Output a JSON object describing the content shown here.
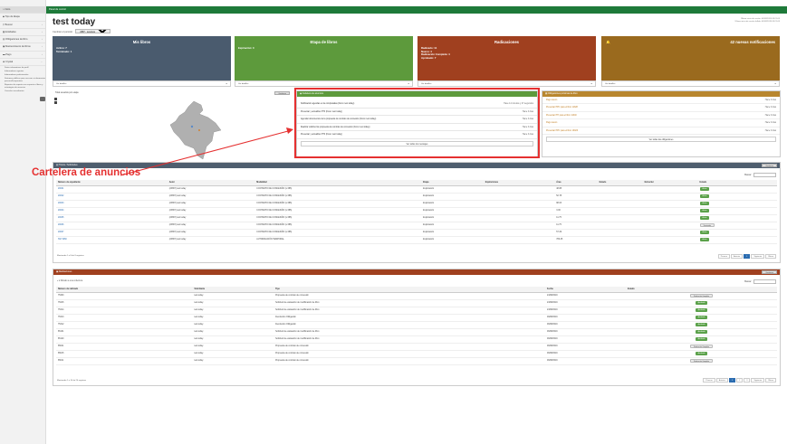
{
  "topbar": {
    "title": "Panel de control"
  },
  "sidebar": {
    "items": [
      {
        "label": "Inicio"
      },
      {
        "label": "Tipo de Etapa"
      },
      {
        "label": "Buscar"
      },
      {
        "label": "Entidades"
      },
      {
        "label": "Obligaciones de libro"
      },
      {
        "label": "Mantenimiento de libros"
      },
      {
        "label": "Pago"
      },
      {
        "label": "Crystal"
      }
    ],
    "subitems": [
      "Datos informativos de perfil",
      "Informadores agentes",
      "Informadores profesionales",
      "Sistemas públicos para accesos a informacion personal/corporativa",
      "Reportes de soporte con respecto a libros y estrategias de anuncios",
      "Cancelar consultantes"
    ]
  },
  "page": {
    "title": "test today",
    "period_label": "Cambiar el periodo:",
    "period_value": "2087 - recursos",
    "last_access": [
      "Último inicio de sesión: 04/09/2019 09:21:03",
      "Último inicio de sesión fallido: 04/09/2019 09:21:03"
    ]
  },
  "cards": [
    {
      "title": "Mis libros",
      "lines": [
        "Activo: 7",
        "Terminado: 1"
      ],
      "footer": "Ver detalles",
      "color": "#4a5b6e"
    },
    {
      "title": "Etapa de libros",
      "lines": [
        "Expiración: 0"
      ],
      "footer": "Ver detalles",
      "color": "#5d9a3c"
    },
    {
      "title": "Radicaciones",
      "lines": [
        "Radicado: 11",
        "Nuevo: 4",
        "Radicación Completa: 4",
        "Aprobado: 7"
      ],
      "footer": "Ver detalles",
      "color": "#a0401f"
    },
    {
      "title": "42 nuevas notificaciones",
      "lines": [],
      "footer": "Ver detalles",
      "color": "#9a6a1e"
    }
  ],
  "map_panel": {
    "title": "Total usuarios por etapa",
    "button": "Gestionar"
  },
  "announcements": {
    "title": "Cartelera de anuncios",
    "rows": [
      {
        "text": "Notificación agendas en la completadas (Fono: test today)",
        "date": "Hace 14 minutos y 47 segundos"
      },
      {
        "text": "Presentar y actualizar PTF (Fono: test today)",
        "date": "Hace 3 días"
      },
      {
        "text": "Agendar documentos de la propuesta de contrato de concesión (Fono: test today)",
        "date": "Hace 3 días"
      },
      {
        "text": "Realizar solicitud de propuesta de contrato de concesión (Fono: test today)",
        "date": "Hace 3 días"
      },
      {
        "text": "Presentar y actualizar PTF (Fono: test today)",
        "date": "Hace 3 días"
      }
    ],
    "more": "Ver todos los mensajes"
  },
  "obligations": {
    "title": "Obligaciones próximas de libro",
    "rows": [
      {
        "text": "Pago canon",
        "date": "Hace 3 días"
      },
      {
        "text": "Presentar PPC para el libro 11328",
        "date": "Hace 3 días"
      },
      {
        "text": "Presentar PTI para el libro 11340",
        "date": "Hace 3 días"
      },
      {
        "text": "Pago canon",
        "date": "Hace 3 días"
      },
      {
        "text": "Presentar PPC para el libro 13026",
        "date": "Hace 3 días"
      }
    ],
    "more": "Ver todas las obligaciones"
  },
  "callout": {
    "label": "Cartelera de anuncios"
  },
  "books": {
    "title": "Títulos / Solicitudes",
    "button": "Gestionar",
    "search_label": "Buscar:",
    "headers": [
      "Número de expediente",
      "Autor",
      "Modalidad",
      "Etapa",
      "Expiraciones",
      "Área",
      "Estado",
      "Estructur",
      "Estado"
    ],
    "rows": [
      {
        "id": "20001",
        "author": "(23867) test today",
        "mod": "CONTRATO DE CONCESIÓN (L 685)",
        "stage": "Exploración",
        "area": "48.88",
        "status": "Activo",
        "gray": false
      },
      {
        "id": "20002",
        "author": "(23867) test today",
        "mod": "CONTRATO DE CONCESIÓN (L 685)",
        "stage": "Exploración",
        "area": "52.78",
        "status": "Activo",
        "gray": false
      },
      {
        "id": "20003",
        "author": "(23867) test today",
        "mod": "CONTRATO DE CONCESIÓN (L 685)",
        "stage": "Exploración",
        "area": "98.03",
        "status": "Activo",
        "gray": false
      },
      {
        "id": "20004",
        "author": "(23867) test today",
        "mod": "CONTRATO DE CONCESIÓN (L 685)",
        "stage": "Exploración",
        "area": "3.06",
        "status": "Activo",
        "gray": false
      },
      {
        "id": "20005",
        "author": "(23867) test today",
        "mod": "CONTRATO DE CONCESIÓN (L 685)",
        "stage": "Exploración",
        "area": "11.75",
        "status": "Activo",
        "gray": false
      },
      {
        "id": "20006",
        "author": "(23867) test today",
        "mod": "CONTRATO DE CONCESIÓN (L 685)",
        "stage": "Exploración",
        "area": "11.75",
        "status": "Terminado",
        "gray": true
      },
      {
        "id": "20007",
        "author": "(23867) test today",
        "mod": "CONTRATO DE CONCESIÓN (L 685)",
        "stage": "Exploración",
        "area": "57.29",
        "status": "Activo",
        "gray": false
      },
      {
        "id": "SSY1060",
        "author": "(23867) test today",
        "mod": "AUTORIZACIÓN TEMPORAL",
        "stage": "Exploración",
        "area": "780.45",
        "status": "Activo",
        "gray": false
      }
    ],
    "footer": "Mostrando 1 a 8 de 8 registros",
    "pager": [
      "Primero",
      "Anterior",
      "1",
      "Siguiente",
      "Último"
    ]
  },
  "radications": {
    "title": "Radicaciones",
    "button": "Gestionar",
    "filter": "Filtrado a una cobertura",
    "search_label": "Buscar:",
    "headers": [
      "Número de radicado",
      "Solicitante",
      "Tipo",
      "Fecha",
      "Estado"
    ],
    "rows": [
      {
        "id": "75303",
        "user": "test.today",
        "type": "Propuesta de contrato de concesión",
        "date": "24/08/2019",
        "status": "Radicación Completa",
        "gray": true
      },
      {
        "id": "75315",
        "user": "test.today",
        "type": "Solicitud de evaluación de modificación de libro",
        "date": "23/08/2019",
        "status": "Aprobado",
        "gray": false
      },
      {
        "id": "75314",
        "user": "test.today",
        "type": "Solicitud de evaluación de modificación de libro",
        "date": "23/08/2019",
        "status": "Aprobado",
        "gray": false
      },
      {
        "id": "75313",
        "user": "test.today",
        "type": "Devolución Obligación",
        "date": "09/08/2019",
        "status": "Aprobado",
        "gray": false
      },
      {
        "id": "75312",
        "user": "test.today",
        "type": "Devolución Obligación",
        "date": "06/08/2019",
        "status": "Aprobado",
        "gray": false
      },
      {
        "id": "65131",
        "user": "test.today",
        "type": "Solicitud de evaluación de modificación de libro",
        "date": "06/08/2019",
        "status": "Aprobado",
        "gray": false
      },
      {
        "id": "65120",
        "user": "test.today",
        "type": "Solicitud de evaluación de modificación de libro",
        "date": "06/08/2019",
        "status": "Aprobado",
        "gray": false
      },
      {
        "id": "65041",
        "user": "test.today",
        "type": "Propuesta de contrato de concesión",
        "date": "06/08/2019",
        "status": "Radicación Completa",
        "gray": true
      },
      {
        "id": "65015",
        "user": "test.today",
        "type": "Propuesta de contrato de concesión",
        "date": "06/08/2019",
        "status": "Aprobado",
        "gray": false
      },
      {
        "id": "65011",
        "user": "test.today",
        "type": "Propuesta de contrato de concesión",
        "date": "06/08/2019",
        "status": "Radicación Completa",
        "gray": true
      }
    ],
    "footer": "Mostrando 1 a 10 de 20 registros",
    "pager": [
      "Primero",
      "Anterior",
      "1",
      "2",
      "3",
      "Siguiente",
      "Último"
    ]
  }
}
